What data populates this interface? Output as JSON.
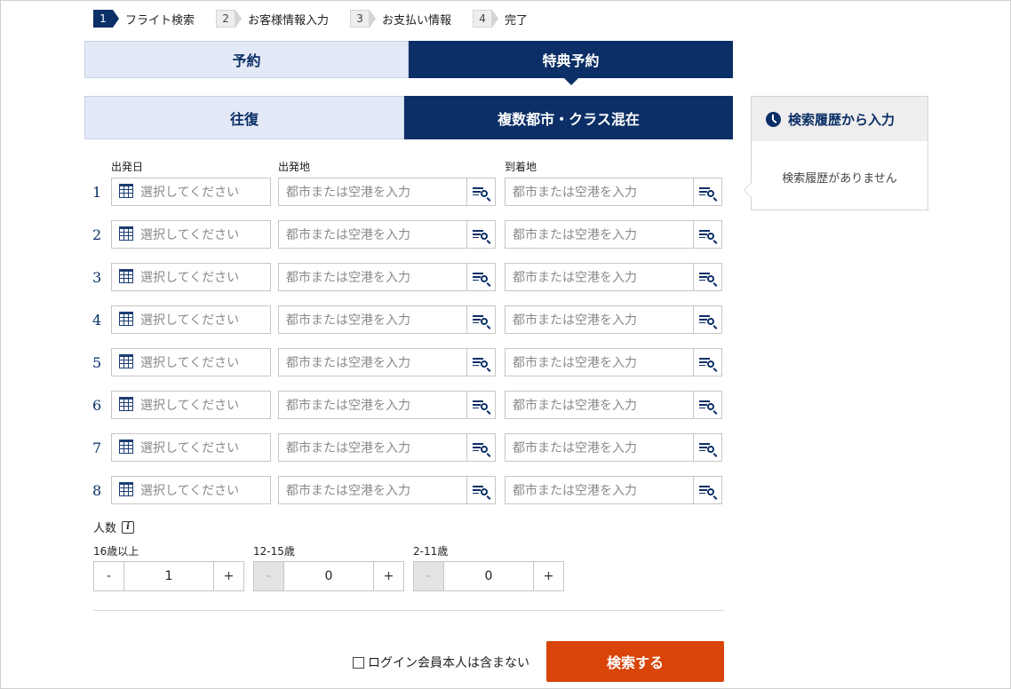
{
  "steps": [
    {
      "num": "1",
      "label": "フライト検索"
    },
    {
      "num": "2",
      "label": "お客様情報入力"
    },
    {
      "num": "3",
      "label": "お支払い情報"
    },
    {
      "num": "4",
      "label": "完了"
    }
  ],
  "booking_tabs": {
    "reservation": "予約",
    "award": "特典予約"
  },
  "trip_tabs": {
    "round_trip": "往復",
    "multi_city": "複数都市・クラス混在"
  },
  "history": {
    "title": "検索履歴から入力",
    "empty": "検索履歴がありません"
  },
  "columns": {
    "date": "出発日",
    "origin": "出発地",
    "destination": "到着地"
  },
  "placeholders": {
    "date": "選択してください",
    "place": "都市または空港を入力"
  },
  "rows": [
    "1",
    "2",
    "3",
    "4",
    "5",
    "6",
    "7",
    "8"
  ],
  "passengers": {
    "title": "人数",
    "info": "i",
    "adult": {
      "label": "16歳以上",
      "value": "1",
      "minus": "-",
      "plus": "+"
    },
    "youth": {
      "label": "12-15歳",
      "value": "0",
      "minus": "-",
      "plus": "+"
    },
    "child": {
      "label": "2-11歳",
      "value": "0",
      "minus": "-",
      "plus": "+"
    }
  },
  "login_exclude": "ログイン会員本人は含まない",
  "search_button": "検索する"
}
